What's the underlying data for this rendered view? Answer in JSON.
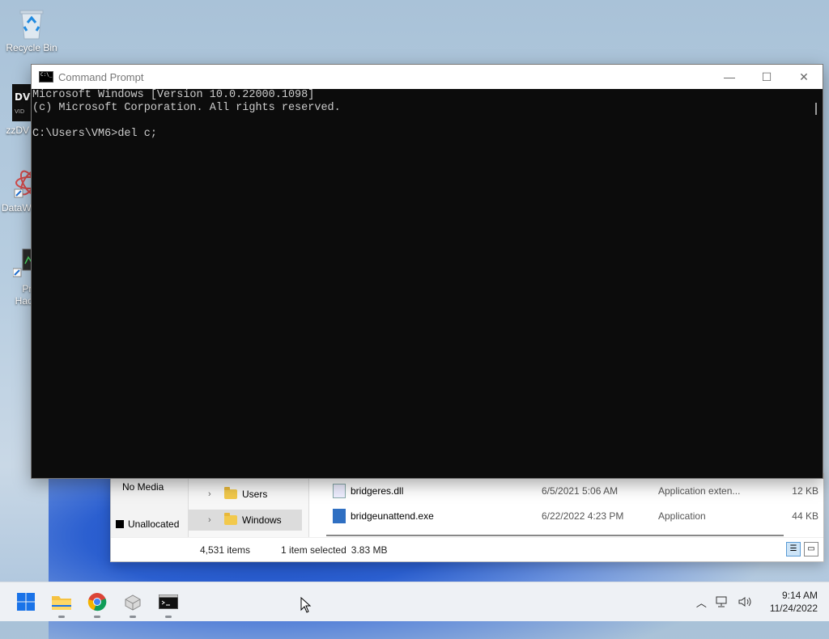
{
  "desktop": {
    "icons": [
      {
        "label": "Recycle Bin",
        "icon": "recycle-bin-icon"
      },
      {
        "label": "zzDV",
        "icon": "dvd-app-icon"
      },
      {
        "label": "DataW",
        "icon": "datawrapper-icon"
      },
      {
        "label": "Pro\nHack",
        "icon": "process-hacker-icon"
      }
    ]
  },
  "cmd": {
    "title": "Command Prompt",
    "lines": "Microsoft Windows [Version 10.0.22000.1098]\n(c) Microsoft Corporation. All rights reserved.\n\nC:\\Users\\VM6>del c;",
    "controls": {
      "minimize": "—",
      "maximize": "☐",
      "close": "✕"
    }
  },
  "explorer": {
    "drive_panel": {
      "no_media": "No Media",
      "unallocated": "Unallocated"
    },
    "tree": [
      {
        "label": "Users",
        "selected": false
      },
      {
        "label": "Windows",
        "selected": true
      }
    ],
    "files": [
      {
        "name": "bridgeres.dll",
        "date": "6/5/2021 5:06 AM",
        "type": "Application exten...",
        "size": "12 KB"
      },
      {
        "name": "bridgeunattend.exe",
        "date": "6/22/2022 4:23 PM",
        "type": "Application",
        "size": "44 KB"
      }
    ],
    "status": {
      "count": "4,531 items",
      "selected": "1 item selected",
      "size": "3.83 MB"
    }
  },
  "taskbar": {
    "apps": [
      {
        "name": "start",
        "icon": "windows-start-icon"
      },
      {
        "name": "file-explorer",
        "icon": "file-explorer-icon"
      },
      {
        "name": "chrome",
        "icon": "chrome-icon"
      },
      {
        "name": "app",
        "icon": "generic-app-icon"
      },
      {
        "name": "command-prompt",
        "icon": "cmd-icon"
      }
    ],
    "time": "9:14 AM",
    "date": "11/24/2022"
  }
}
